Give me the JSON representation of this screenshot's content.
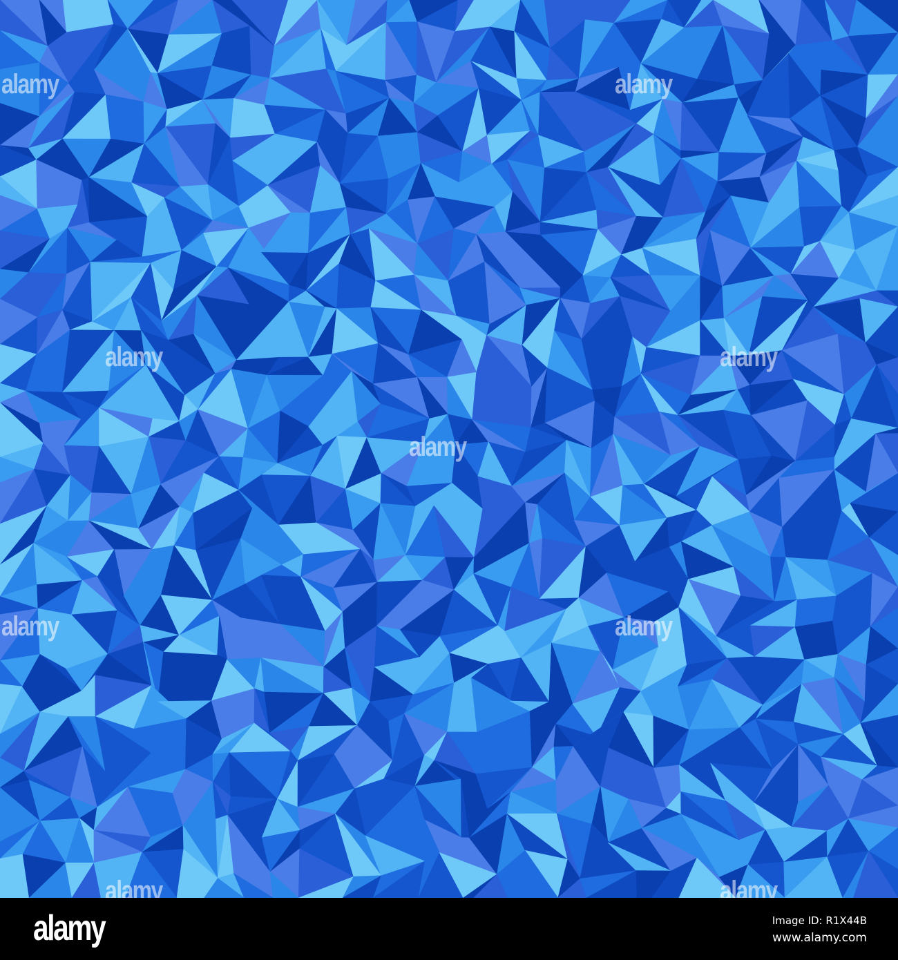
{
  "watermark_text": "alamy",
  "footer": {
    "logo": "alamy",
    "image_id": "Image ID: R1X44B",
    "website": "www.alamy.com"
  },
  "palette": [
    "#0a3fb0",
    "#1556cf",
    "#1e6ce0",
    "#2a86e8",
    "#3a9cf0",
    "#52b4f5",
    "#6ec8f8",
    "#2b5fd8",
    "#4a7de8",
    "#0f4ac0"
  ]
}
